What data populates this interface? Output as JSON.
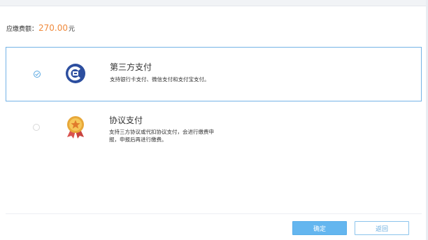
{
  "payment": {
    "amount_label": "应缴费额：",
    "amount_value": "270.00",
    "amount_unit": "元"
  },
  "options": [
    {
      "title": "第三方支付",
      "description": "支持银行卡支付、微信支付和支付宝支付。",
      "selected": true,
      "icon": "bank-logo-icon"
    },
    {
      "title": "协议支付",
      "description": "支持三方协议或代扣协议支付，会进行缴费申报，申报后再进行缴费。",
      "selected": false,
      "icon": "medal-icon"
    }
  ],
  "footer": {
    "confirm_label": "确定",
    "back_label": "返回"
  },
  "colors": {
    "accent": "#64b6ef",
    "amount": "#f08a3c",
    "selected_border": "#74b3e6",
    "bank_logo": "#2c4e9f",
    "medal_gold": "#e8a83a",
    "medal_ribbon": "#d9534f"
  }
}
